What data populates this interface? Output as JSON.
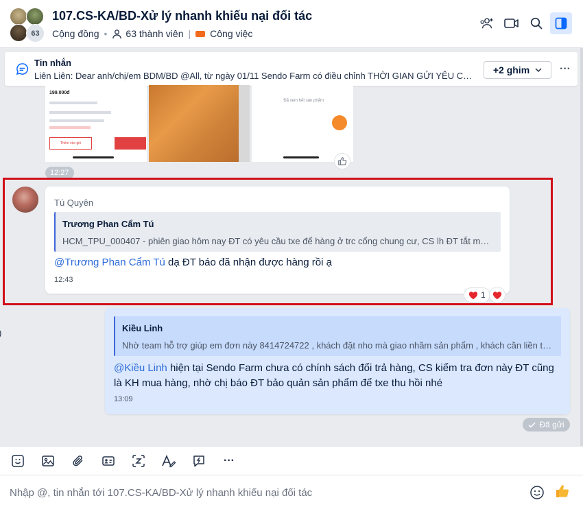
{
  "header": {
    "title": "107.CS-KA/BD-Xử lý nhanh khiếu nại đối tác",
    "member_badge": "63",
    "community_label": "Cộng đồng",
    "members_label": "63 thành viên",
    "tag_label": "Công việc"
  },
  "pinned": {
    "title": "Tin nhắn",
    "text": "Liên Liên: Dear anh/chị/em BDM/BD @All, từ ngày 01/11 Sendo Farm có điều chỉnh THỜI GIAN GỬI YÊU CẦU...",
    "pins_button": "+2 ghim",
    "more_label": "···"
  },
  "prior_message": {
    "time": "12:27",
    "shot1_price": "199.000đ",
    "shot1_button": "Thêm vào giỏ",
    "shot3_text": "Đã xem hết sản phẩm"
  },
  "highlighted_message": {
    "sender": "Tú Quyên",
    "quote_name": "Trương Phan Cẩm Tú",
    "quote_text": "HCM_TPU_000407 - phiên giao hôm nay ĐT có yêu cầu txe để hàng ở trc cổng chung cư, CS lh ĐT tắt máy ...",
    "mention": "@Trương Phan Cẩm Tú",
    "text": " dạ ĐT báo đã nhận được hàng rồi ạ",
    "time": "12:43",
    "reaction_count": "1"
  },
  "outgoing_message": {
    "quote_name": "Kiều Linh",
    "quote_text": "Nhờ team hỗ trợ giúp em đơn này 8414724722 , khách đặt nho mà giao nhầm sản phẩm , khách cần liền tro...",
    "mention": "@Kiều Linh",
    "text": " hiện tại Sendo Farm chưa có chính sách đổi trả hàng, CS kiểm tra đơn này ĐT cũng là KH mua hàng, nhờ chị báo ĐT bảo quản sản phẩm để txe thu hồi nhé",
    "time": "13:09",
    "status": "Đã gửi"
  },
  "composer": {
    "placeholder": "Nhập @, tin nhắn tới 107.CS-KA/BD-Xử lý nhanh khiếu nại đối tác",
    "more_label": "···"
  },
  "colors": {
    "accent": "#2c6bd8",
    "highlight_border": "#d10f19",
    "outgoing_bubble": "#dbe8fe",
    "tag": "#f26a1b"
  },
  "icons": {
    "header": [
      "add-member-icon",
      "video-call-icon",
      "search-icon",
      "sidebar-toggle-icon"
    ],
    "toolbar": [
      "sticker-icon",
      "image-icon",
      "attachment-icon",
      "contact-card-icon",
      "screenshot-icon",
      "format-text-icon",
      "quick-message-icon",
      "more-icon"
    ]
  }
}
